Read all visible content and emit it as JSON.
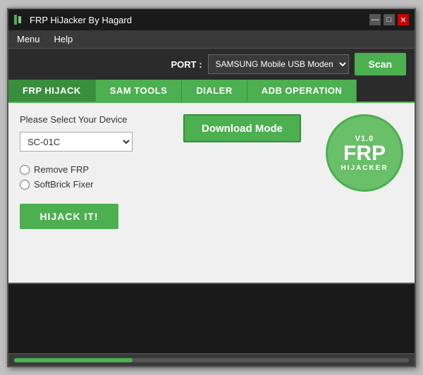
{
  "titleBar": {
    "title": "FRP HiJacker By Hagard",
    "minLabel": "—",
    "maxLabel": "□",
    "closeLabel": "✕"
  },
  "menuBar": {
    "items": [
      "Menu",
      "Help"
    ]
  },
  "portBar": {
    "portLabel": "PORT :",
    "portValue": "SAMSUNG Mobile USB Modem (…",
    "scanLabel": "Scan"
  },
  "tabs": [
    {
      "id": "frp-hijack",
      "label": "FRP HIJACK",
      "active": true
    },
    {
      "id": "sam-tools",
      "label": "SAM TOOLS",
      "active": false
    },
    {
      "id": "dialer",
      "label": "DIALER",
      "active": false
    },
    {
      "id": "adb-operation",
      "label": "ADB OPERATION",
      "active": false
    }
  ],
  "frpHijack": {
    "deviceLabel": "Please Select Your Device",
    "deviceValue": "SC-01C",
    "downloadModeLabel": "Download Mode",
    "radioOptions": [
      {
        "id": "remove-frp",
        "label": "Remove FRP"
      },
      {
        "id": "softbrick-fixer",
        "label": "SoftBrick Fixer"
      }
    ],
    "hijackBtnLabel": "HIJACK IT!",
    "frpLogo": {
      "version": "V1.0",
      "mainText": "FRP",
      "subText": "HIJACKER"
    }
  },
  "statusBar": {
    "fillPercent": 30
  }
}
